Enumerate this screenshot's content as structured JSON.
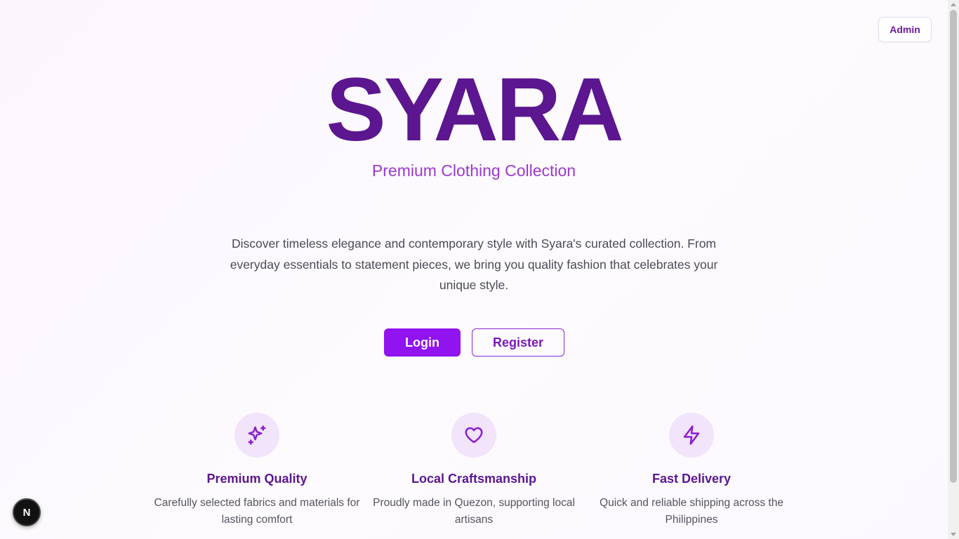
{
  "header": {
    "admin_label": "Admin"
  },
  "hero": {
    "brand": "SYARA",
    "tagline": "Premium Clothing Collection",
    "intro": "Discover timeless elegance and contemporary style with Syara's curated collection. From everyday essentials to statement pieces, we bring you quality fashion that celebrates your unique style."
  },
  "actions": {
    "login_label": "Login",
    "register_label": "Register"
  },
  "features": [
    {
      "icon": "sparkles-icon",
      "title": "Premium Quality",
      "desc": "Carefully selected fabrics and materials for lasting comfort"
    },
    {
      "icon": "heart-icon",
      "title": "Local Craftsmanship",
      "desc": "Proudly made in Quezon, supporting local artisans"
    },
    {
      "icon": "lightning-icon",
      "title": "Fast Delivery",
      "desc": "Quick and reliable shipping across the Philippines"
    }
  ],
  "dev_badge": {
    "label": "N"
  },
  "colors": {
    "brand": "#5b1690",
    "accent": "#9013f0",
    "tagline": "#9a3ad0",
    "icon_bg": "#f2e4fb"
  }
}
